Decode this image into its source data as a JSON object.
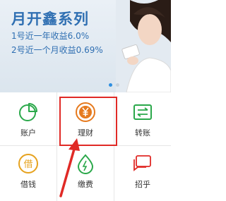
{
  "banner": {
    "title": "月开鑫系列",
    "line1": "1号近一年收益6.0%",
    "line2": "2号近一个月收益0.69%"
  },
  "grid": {
    "items": [
      {
        "label": "账户",
        "icon": "pie-chart-icon"
      },
      {
        "label": "理财",
        "icon": "yuan-coin-icon"
      },
      {
        "label": "转账",
        "icon": "transfer-icon"
      },
      {
        "label": "借钱",
        "icon": "borrow-icon"
      },
      {
        "label": "缴费",
        "icon": "water-drop-icon"
      },
      {
        "label": "招乎",
        "icon": "chat-bubble-icon"
      }
    ]
  },
  "colors": {
    "brand_blue": "#2f6fb2",
    "green": "#2aa84a",
    "orange": "#e67a1e",
    "red": "#e02a26"
  }
}
